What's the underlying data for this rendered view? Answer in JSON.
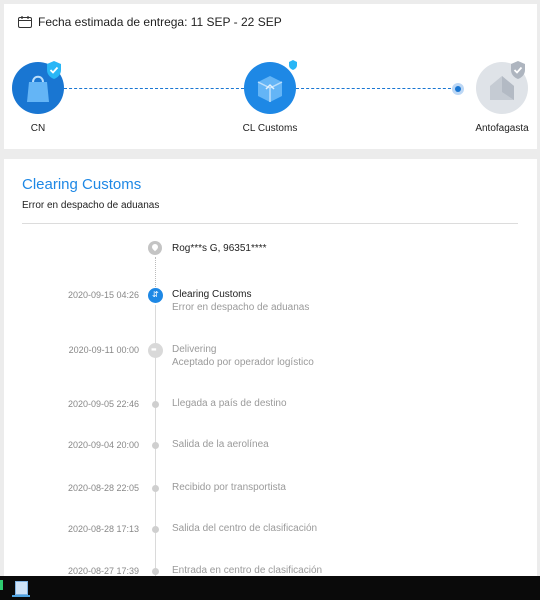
{
  "header": {
    "eta_label": "Fecha estimada de entrega: 11 SEP - 22 SEP",
    "icon": "calendar-icon"
  },
  "route": {
    "origin": {
      "label": "CN",
      "icon": "shopping-bag-icon",
      "status": "done"
    },
    "customs": {
      "label": "CL Customs",
      "icon": "customs-box-icon",
      "status": "current"
    },
    "destination": {
      "label": "Antofagasta",
      "icon": "house-icon",
      "status": "pending"
    },
    "colors": {
      "active": "#1976d2",
      "pending": "#dfe3e8",
      "badge": "#29b6f6"
    }
  },
  "status": {
    "title": "Clearing Customs",
    "subtitle": "Error en despacho de aduanas"
  },
  "recipient": {
    "text": "Rog***s G,  96351****",
    "icon": "location-pin-icon"
  },
  "events": [
    {
      "date": "2020-09-15 04:26",
      "title": "Clearing Customs",
      "desc": "Error en despacho de aduanas",
      "state": "active"
    },
    {
      "date": "2020-09-11 00:00",
      "title": "Delivering",
      "desc": "Aceptado por operador logístico",
      "state": "milestone"
    },
    {
      "date": "2020-09-05 22:46",
      "title": "Llegada a país de destino",
      "desc": "",
      "state": "past"
    },
    {
      "date": "2020-09-04 20:00",
      "title": "Salida de la aerolínea",
      "desc": "",
      "state": "past"
    },
    {
      "date": "2020-08-28 22:05",
      "title": "Recibido por transportista",
      "desc": "",
      "state": "past"
    },
    {
      "date": "2020-08-28 17:13",
      "title": "Salida del centro de clasificación",
      "desc": "",
      "state": "past"
    },
    {
      "date": "2020-08-27 17:39",
      "title": "Entrada en centro de clasificación",
      "desc": "",
      "state": "past"
    }
  ],
  "taskbar": {
    "app_icon": "notepad-app-icon"
  }
}
